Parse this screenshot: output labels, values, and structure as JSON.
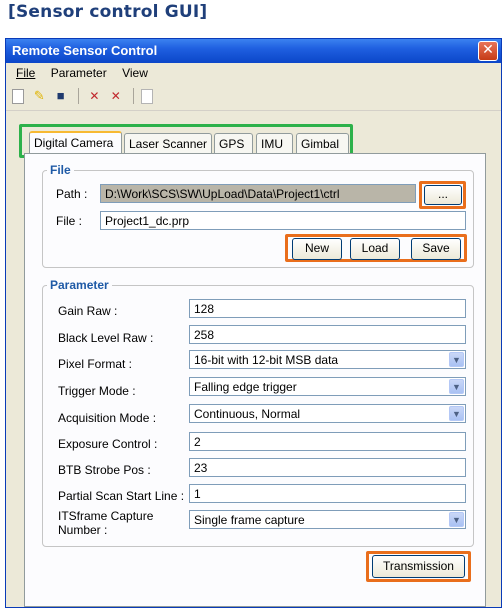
{
  "caption": "[Sensor control GUI]",
  "window": {
    "title": "Remote Sensor Control",
    "close_glyph": "✕"
  },
  "menu": {
    "file": "File",
    "parameter": "Parameter",
    "view": "View"
  },
  "tabs": [
    {
      "label": "Digital Camera",
      "active": true
    },
    {
      "label": "Laser Scanner",
      "active": false
    },
    {
      "label": "GPS",
      "active": false
    },
    {
      "label": "IMU",
      "active": false
    },
    {
      "label": "Gimbal",
      "active": false
    }
  ],
  "file_group": {
    "legend": "File",
    "path_label": "Path :",
    "path_value": "D:\\Work\\SCS\\SW\\UpLoad\\Data\\Project1\\ctrl",
    "browse_label": "...",
    "file_label": "File :",
    "file_value": "Project1_dc.prp",
    "new_label": "New",
    "load_label": "Load",
    "save_label": "Save"
  },
  "param_group": {
    "legend": "Parameter",
    "rows": [
      {
        "label": "Gain Raw :",
        "value": "128",
        "type": "text"
      },
      {
        "label": "Black Level Raw :",
        "value": "258",
        "type": "text"
      },
      {
        "label": "Pixel Format :",
        "value": "16-bit with 12-bit MSB data",
        "type": "select"
      },
      {
        "label": "Trigger Mode :",
        "value": "Falling edge trigger",
        "type": "select"
      },
      {
        "label": "Acquisition Mode :",
        "value": "Continuous, Normal",
        "type": "select"
      },
      {
        "label": "Exposure Control :",
        "value": "2",
        "type": "text"
      },
      {
        "label": "BTB Strobe Pos :",
        "value": "23",
        "type": "text"
      },
      {
        "label": "Partial Scan Start Line :",
        "value": "1",
        "type": "text"
      },
      {
        "label_line1": "ITSframe Capture",
        "label_line2": "Number :",
        "value": "Single frame capture",
        "type": "select"
      }
    ]
  },
  "transmission_label": "Transmission",
  "colors": {
    "highlight_tabs": "#2db14a",
    "highlight_buttons": "#e96e1c",
    "group_legend": "#1f5aa6",
    "titlebar": "#0b46c8"
  }
}
